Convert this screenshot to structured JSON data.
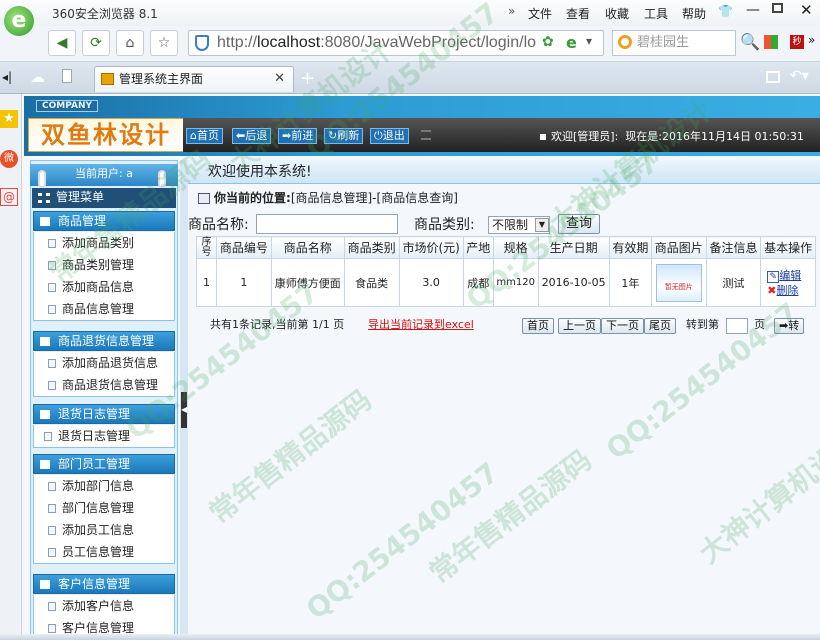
{
  "browser": {
    "title": "360安全浏览器 8.1",
    "menu": [
      "文件",
      "查看",
      "收藏",
      "工具",
      "帮助"
    ],
    "url_prefix": "http://",
    "url_host": "localhost",
    "url_rest": ":8080/JavaWebProject/login/lo",
    "search_placeholder": "碧桂园生",
    "tab_title": "管理系统主界面",
    "new_tab": "+"
  },
  "app": {
    "company": "COMPANY",
    "logo": "双鱼林设计",
    "nav": [
      "首页",
      "后退",
      "前进",
      "刷新",
      "退出"
    ],
    "welcome_user": "欢迎[管理员]:",
    "date_label": "现在是:",
    "date_value": "2016年11月14日 01:50:31"
  },
  "sidebar": {
    "current_user": "当前用户: a",
    "menu_title": "管理菜单",
    "sections": [
      {
        "title": "商品管理",
        "items": [
          "添加商品类别",
          "商品类别管理",
          "添加商品信息",
          "商品信息管理"
        ]
      },
      {
        "title": "商品退货信息管理",
        "items": [
          "添加商品退货信息",
          "商品退货信息管理"
        ]
      },
      {
        "title": "退货日志管理",
        "items": [
          "退货日志管理"
        ]
      },
      {
        "title": "部门员工管理",
        "items": [
          "添加部门信息",
          "部门信息管理",
          "添加员工信息",
          "员工信息管理"
        ]
      },
      {
        "title": "客户信息管理",
        "items": [
          "添加客户信息",
          "客户信息管理"
        ]
      }
    ]
  },
  "main": {
    "welcome": "欢迎使用本系统!",
    "breadcrumb_label": "你当前的位置:",
    "breadcrumb_path": "[商品信息管理]-[商品信息查询]",
    "filter_name_label": "商品名称:",
    "filter_name_value": "",
    "filter_type_label": "商品类别:",
    "filter_type_value": "不限制",
    "query_button": "查询",
    "columns": [
      "序号",
      "商品编号",
      "商品名称",
      "商品类别",
      "市场价(元)",
      "产地",
      "规格",
      "生产日期",
      "有效期",
      "商品图片",
      "备注信息",
      "基本操作"
    ],
    "rows": [
      {
        "seq": "1",
        "code": "1",
        "name": "康师傅方便面",
        "type": "食品类",
        "price": "3.0",
        "origin": "成都",
        "spec": "mm120",
        "date": "2016-10-05",
        "valid": "1年",
        "image_text": "暂无图片",
        "remark": "测试",
        "edit": "编辑",
        "delete": "删除"
      }
    ],
    "pager_summary": "共有1条记录,当前第 1/1 页",
    "export_link": "导出当前记录到excel",
    "first_page": "首页",
    "prev_page": "上一页",
    "next_page": "下一页",
    "last_page": "尾页",
    "goto_label": "转到第",
    "goto_value": "",
    "page_unit": "页",
    "goto_button": "转"
  },
  "watermark": {
    "qq": "QQ:254540457",
    "text1": "常年售精品源码",
    "text2": "大神计算机设计"
  },
  "colors": {
    "header_blue": "#2d9bd4",
    "section_blue": "#1b78bb",
    "export_red": "#d01010",
    "watermark_green": "#46aa5a"
  }
}
